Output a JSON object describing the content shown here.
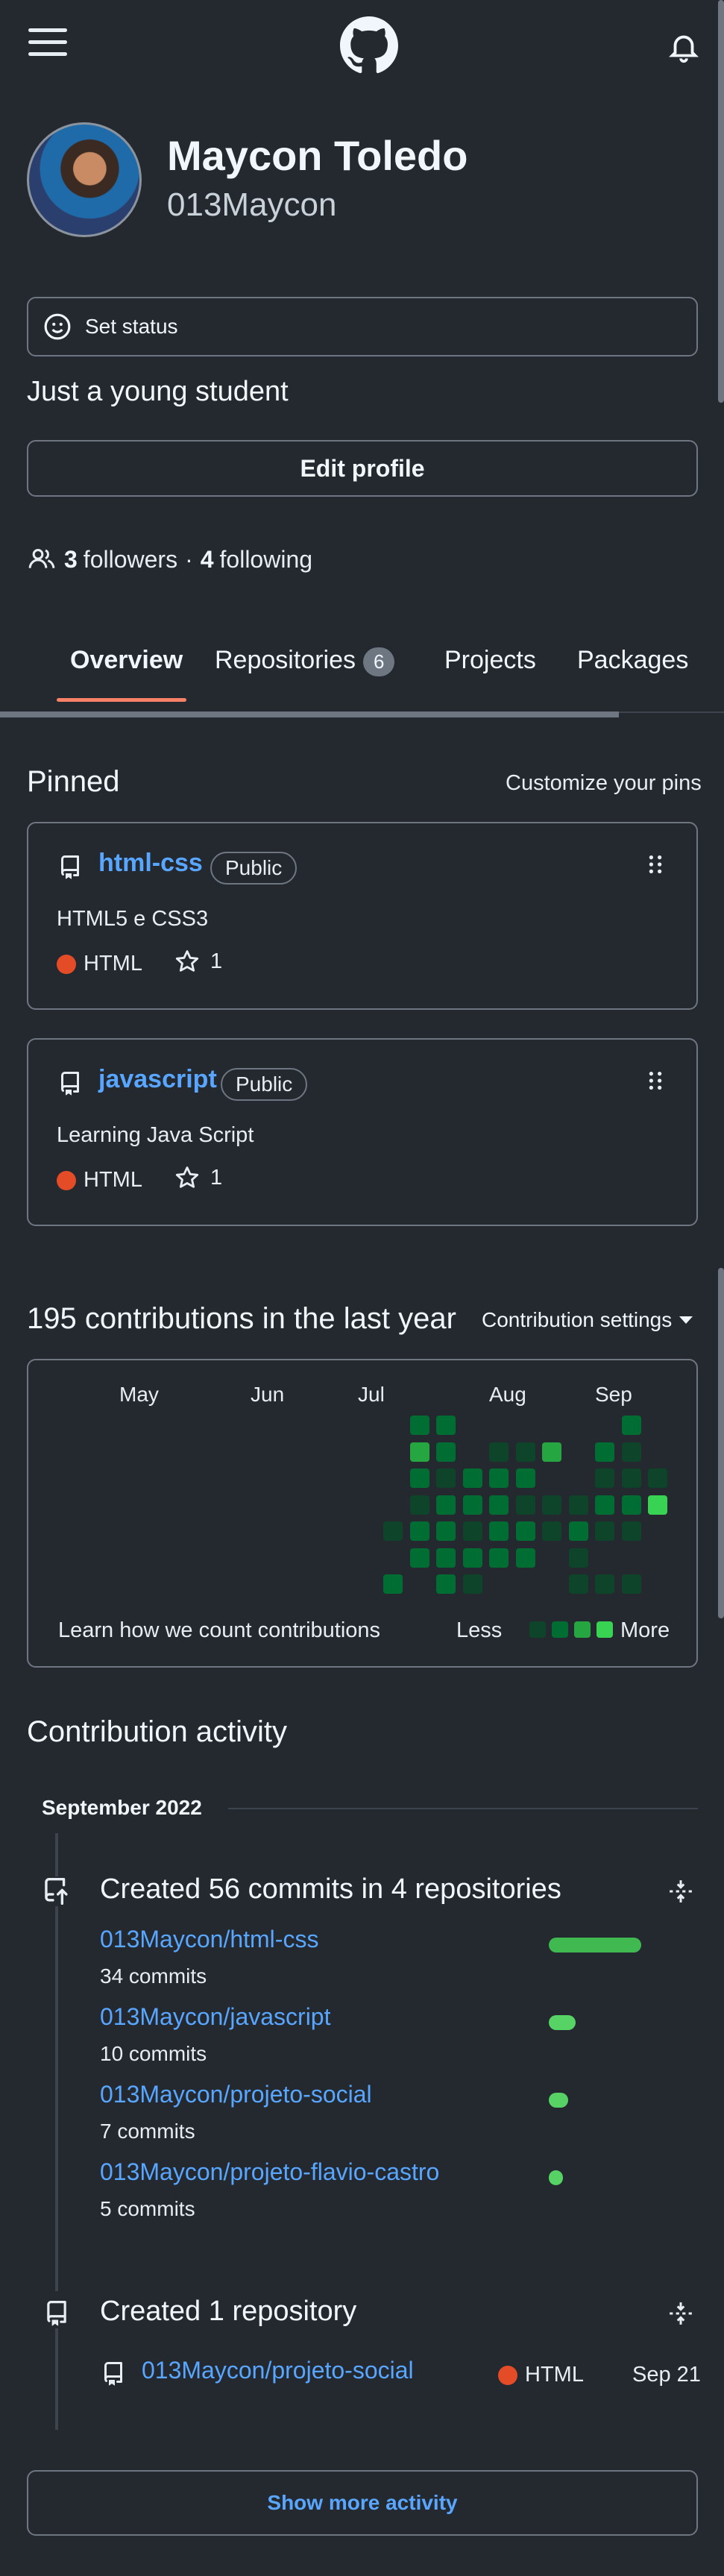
{
  "header": {
    "menu_icon": "hamburger-icon",
    "logo_icon": "github-logo-icon",
    "bell_icon": "bell-icon"
  },
  "profile": {
    "name": "Maycon Toledo",
    "login": "013Maycon",
    "status_label": "Set status",
    "bio": "Just a young student",
    "edit_label": "Edit profile",
    "followers_count": "3",
    "followers_label": "followers",
    "sep": "·",
    "following_count": "4",
    "following_label": "following"
  },
  "tabs": [
    {
      "label": "Overview",
      "active": true
    },
    {
      "label": "Repositories",
      "count": "6"
    },
    {
      "label": "Projects"
    },
    {
      "label": "Packages"
    }
  ],
  "pinned": {
    "title": "Pinned",
    "customize_label": "Customize your pins",
    "repos": [
      {
        "name": "html-css",
        "visibility": "Public",
        "description": "HTML5 e CSS3",
        "language": "HTML",
        "language_color": "#e34c26",
        "stars": "1"
      },
      {
        "name": "javascript",
        "visibility": "Public",
        "description": "Learning Java Script",
        "language": "HTML",
        "language_color": "#e34c26",
        "stars": "1"
      }
    ]
  },
  "contributions": {
    "title": "195 contributions in the last year",
    "settings_label": "Contribution settings",
    "months": [
      "May",
      "Jun",
      "Jul",
      "Aug",
      "Sep"
    ],
    "learn_label": "Learn how we count contributions",
    "less_label": "Less",
    "more_label": "More",
    "colors": [
      "#0e4429",
      "#006d32",
      "#26a641",
      "#39d353"
    ],
    "cells": [
      [
        12,
        0,
        1
      ],
      [
        12,
        1,
        2
      ],
      [
        12,
        2,
        1
      ],
      [
        12,
        3,
        0
      ],
      [
        12,
        4,
        1
      ],
      [
        12,
        5,
        1
      ],
      [
        13,
        0,
        1
      ],
      [
        13,
        1,
        1
      ],
      [
        13,
        2,
        0
      ],
      [
        13,
        3,
        1
      ],
      [
        13,
        4,
        1
      ],
      [
        13,
        5,
        1
      ],
      [
        13,
        6,
        1
      ],
      [
        11,
        4,
        0
      ],
      [
        11,
        6,
        1
      ],
      [
        14,
        2,
        1
      ],
      [
        14,
        3,
        1
      ],
      [
        14,
        4,
        0
      ],
      [
        14,
        5,
        1
      ],
      [
        14,
        6,
        0
      ],
      [
        15,
        1,
        0
      ],
      [
        15,
        2,
        1
      ],
      [
        15,
        3,
        1
      ],
      [
        15,
        4,
        1
      ],
      [
        15,
        5,
        1
      ],
      [
        16,
        1,
        0
      ],
      [
        16,
        2,
        1
      ],
      [
        16,
        3,
        0
      ],
      [
        16,
        4,
        1
      ],
      [
        16,
        5,
        1
      ],
      [
        17,
        1,
        2
      ],
      [
        17,
        3,
        0
      ],
      [
        17,
        4,
        0
      ],
      [
        18,
        3,
        0
      ],
      [
        18,
        4,
        1
      ],
      [
        18,
        5,
        0
      ],
      [
        18,
        6,
        0
      ],
      [
        19,
        1,
        1
      ],
      [
        19,
        2,
        0
      ],
      [
        19,
        3,
        1
      ],
      [
        19,
        4,
        0
      ],
      [
        19,
        6,
        0
      ],
      [
        20,
        0,
        1
      ],
      [
        20,
        1,
        0
      ],
      [
        20,
        2,
        0
      ],
      [
        20,
        3,
        1
      ],
      [
        20,
        4,
        0
      ],
      [
        20,
        6,
        0
      ],
      [
        21,
        2,
        0
      ],
      [
        21,
        3,
        3
      ]
    ]
  },
  "activity": {
    "title": "Contribution activity",
    "month": "September 2022",
    "commits": {
      "title": "Created 56 commits in 4 repositories",
      "items": [
        {
          "repo": "013Maycon/html-css",
          "count": "34 commits",
          "share": 1.0
        },
        {
          "repo": "013Maycon/javascript",
          "count": "10 commits",
          "share": 0.29
        },
        {
          "repo": "013Maycon/projeto-social",
          "count": "7 commits",
          "share": 0.21
        },
        {
          "repo": "013Maycon/projeto-flavio-castro",
          "count": "5 commits",
          "share": 0.15
        }
      ]
    },
    "created": {
      "title": "Created 1 repository",
      "repo": "013Maycon/projeto-social",
      "language": "HTML",
      "language_color": "#e34c26",
      "date": "Sep 21"
    },
    "show_more": "Show more activity"
  }
}
